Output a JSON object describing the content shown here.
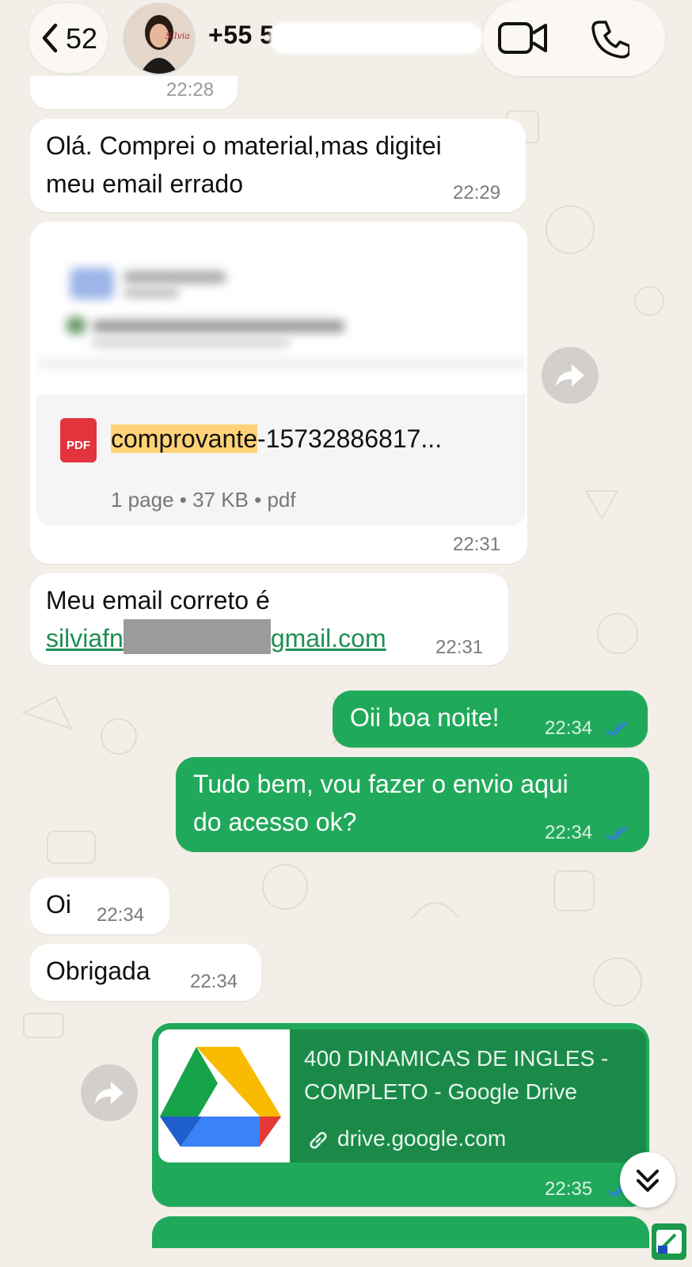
{
  "header": {
    "back_count": "52",
    "contact_number": "+55 51",
    "avatar_text": "Silvia"
  },
  "messages": [
    {
      "type": "text",
      "dir": "in",
      "time": "22:28"
    },
    {
      "type": "text",
      "dir": "in",
      "text_line1": "Olá. Comprei o material,mas digitei",
      "text_line2": "meu email errado",
      "time": "22:29"
    },
    {
      "type": "document",
      "dir": "in",
      "icon": "PDF",
      "name_highlight": "comprovante",
      "name_rest": "-15732886817...",
      "meta": "1 page • 37 KB • pdf",
      "time": "22:31"
    },
    {
      "type": "text",
      "dir": "in",
      "text_line1": "Meu email correto é",
      "email_start": "silviafn",
      "email_end": "gmail.com",
      "time": "22:31"
    },
    {
      "type": "text",
      "dir": "out",
      "text": "Oii boa noite!",
      "time": "22:34",
      "status": "read"
    },
    {
      "type": "text",
      "dir": "out",
      "text_line1": "Tudo bem, vou fazer o envio aqui",
      "text_line2": "do acesso ok?",
      "time": "22:34",
      "status": "read"
    },
    {
      "type": "text",
      "dir": "in",
      "text": "Oi",
      "time": "22:34"
    },
    {
      "type": "text",
      "dir": "in",
      "text": "Obrigada",
      "time": "22:34"
    },
    {
      "type": "link",
      "dir": "out",
      "title_line1": "400 DINAMICAS DE INGLES -",
      "title_line2": "COMPLETO - Google Drive",
      "url": "drive.google.com",
      "time": "22:35",
      "status": "read"
    }
  ],
  "colors": {
    "background": "#f3efe8",
    "outgoing": "#21a95b",
    "incoming": "#ffffff",
    "read_ticks": "#2f80d8",
    "highlight": "#ffd278",
    "link": "#1f8f52"
  }
}
